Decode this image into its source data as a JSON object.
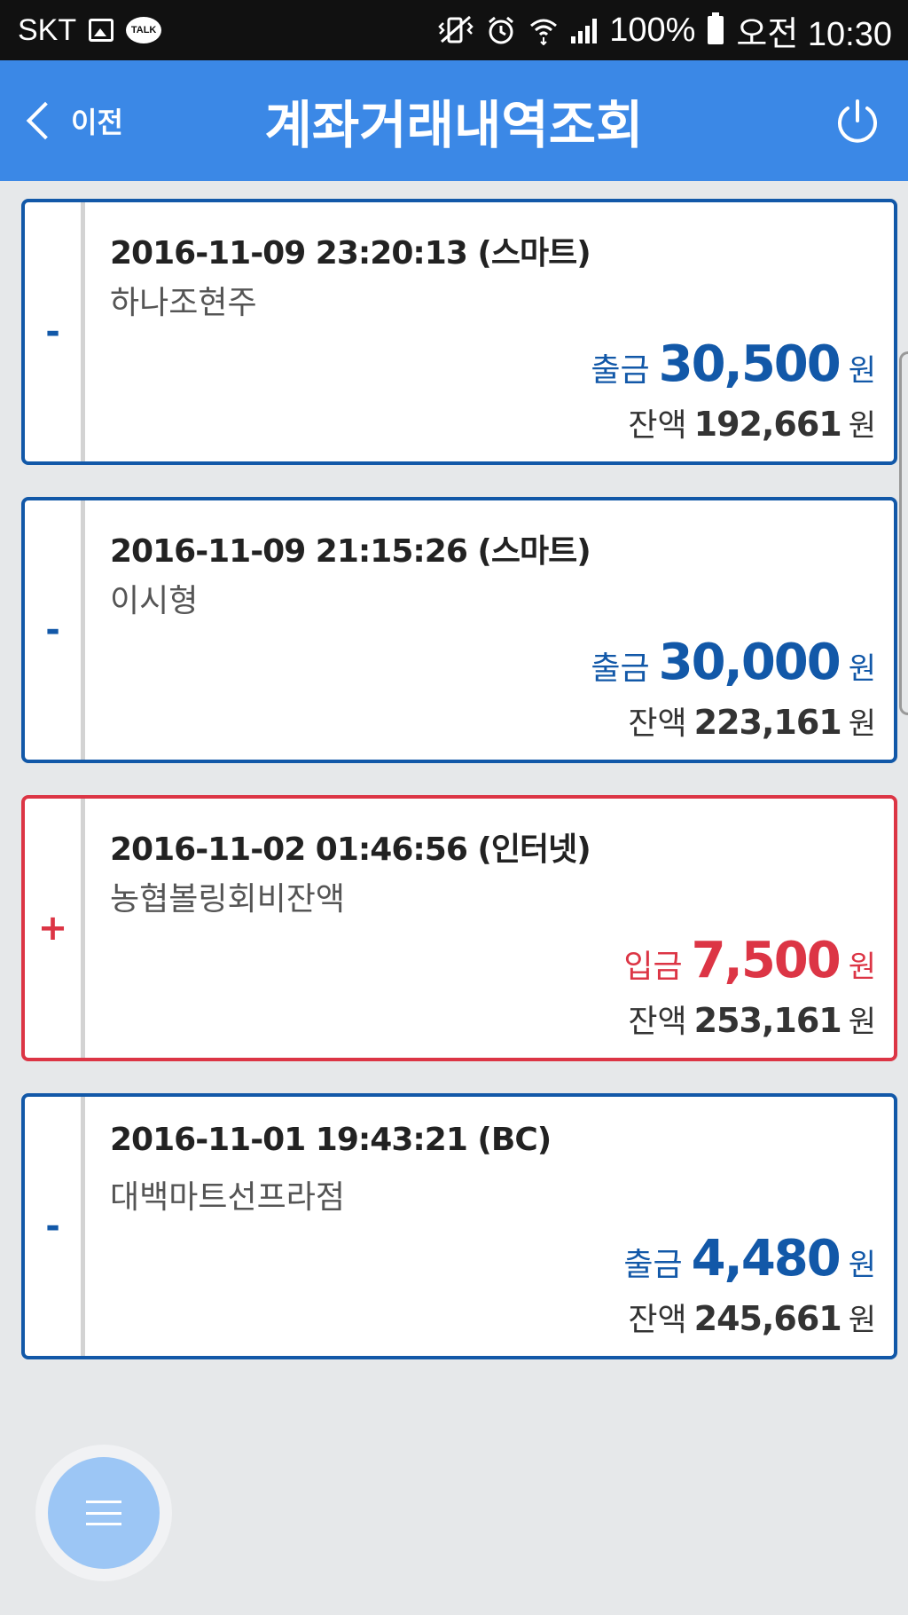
{
  "status_bar": {
    "carrier": "SKT",
    "talk_badge": "TALK",
    "battery": "100%",
    "time": "오전 10:30"
  },
  "header": {
    "back_label": "이전",
    "title": "계좌거래내역조회"
  },
  "colors": {
    "header_bg": "#3b88e6",
    "withdrawal": "#1258a8",
    "deposit": "#dc3545"
  },
  "transactions": [
    {
      "sign": "-",
      "datetime": "2016-11-09 23:20:13 (스마트)",
      "description": "하나조현주",
      "type": "출금",
      "amount": "30,500",
      "unit": "원",
      "balance_label": "잔액",
      "balance": "192,661",
      "balance_unit": "원"
    },
    {
      "sign": "-",
      "datetime": "2016-11-09 21:15:26 (스마트)",
      "description": "이시형",
      "type": "출금",
      "amount": "30,000",
      "unit": "원",
      "balance_label": "잔액",
      "balance": "223,161",
      "balance_unit": "원"
    },
    {
      "sign": "+",
      "datetime": "2016-11-02 01:46:56 (인터넷)",
      "description": "농협볼링회비잔액",
      "type": "입금",
      "amount": "7,500",
      "unit": "원",
      "balance_label": "잔액",
      "balance": "253,161",
      "balance_unit": "원"
    },
    {
      "sign": "-",
      "datetime": "2016-11-01 19:43:21 (BC)",
      "description": "대백마트선프라점",
      "type": "출금",
      "amount": "4,480",
      "unit": "원",
      "balance_label": "잔액",
      "balance": "245,661",
      "balance_unit": "원"
    }
  ]
}
